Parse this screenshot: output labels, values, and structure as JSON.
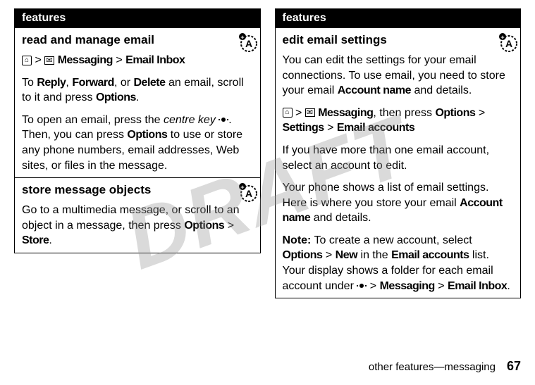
{
  "watermark": "DRAFT",
  "left": {
    "header": "features",
    "rows": [
      {
        "title": "read and manage email",
        "hasBadge": true,
        "pathPrefixIcon1": "home",
        "pathGt1": ">",
        "pathIcon2": "msg",
        "pathBold1": "Messaging",
        "pathGt2": ">",
        "pathBold2": "Email Inbox",
        "p1a": "To ",
        "p1bold1": "Reply",
        "p1b": ", ",
        "p1bold2": "Forward",
        "p1c": ", or ",
        "p1bold3": "Delete",
        "p1d": " an email, scroll to it and press ",
        "p1bold4": "Options",
        "p1e": ".",
        "p2a": "To open an email, press the ",
        "p2italic": "centre key",
        "p2b": " ",
        "p2c": ". Then, you can press ",
        "p2bold1": "Options",
        "p2d": " to use or store any phone numbers, email addresses, Web sites, or files in the message."
      },
      {
        "title": "store message objects",
        "hasBadge": true,
        "p1a": "Go to a multimedia message, or scroll to an object in a message, then press ",
        "p1bold1": "Options",
        "p1b": " > ",
        "p1bold2": "Store",
        "p1c": "."
      }
    ]
  },
  "right": {
    "header": "features",
    "row": {
      "title": "edit email settings",
      "hasBadge": true,
      "p1a": "You can edit the settings for your email connections. To use email, you need to store your email ",
      "p1bold1": "Account name",
      "p1b": " and details.",
      "pathGt1": ">",
      "pathBold1": "Messaging",
      "p2b": ", then press ",
      "pathBold2": "Options",
      "pathGt2": ">",
      "pathBold3": "Settings",
      "pathGt3": ">",
      "pathBold4": "Email accounts",
      "p3": "If you have more than one email account, select an account to edit.",
      "p4a": "Your phone shows a list of email settings. Here is where you store your email ",
      "p4bold1": "Account name",
      "p4b": " and details.",
      "p5note": "Note:",
      "p5a": " To create a new account, select ",
      "p5bold1": "Options",
      "p5b": " > ",
      "p5bold2": "New",
      "p5c": " in the ",
      "p5bold3": "Email accounts",
      "p5d": " list. Your display shows a folder for each email account under ",
      "p5e": " > ",
      "p5bold4": "Messaging",
      "p5f": " > ",
      "p5bold5": "Email Inbox",
      "p5g": "."
    }
  },
  "footer": {
    "text": "other features—messaging",
    "page": "67"
  }
}
